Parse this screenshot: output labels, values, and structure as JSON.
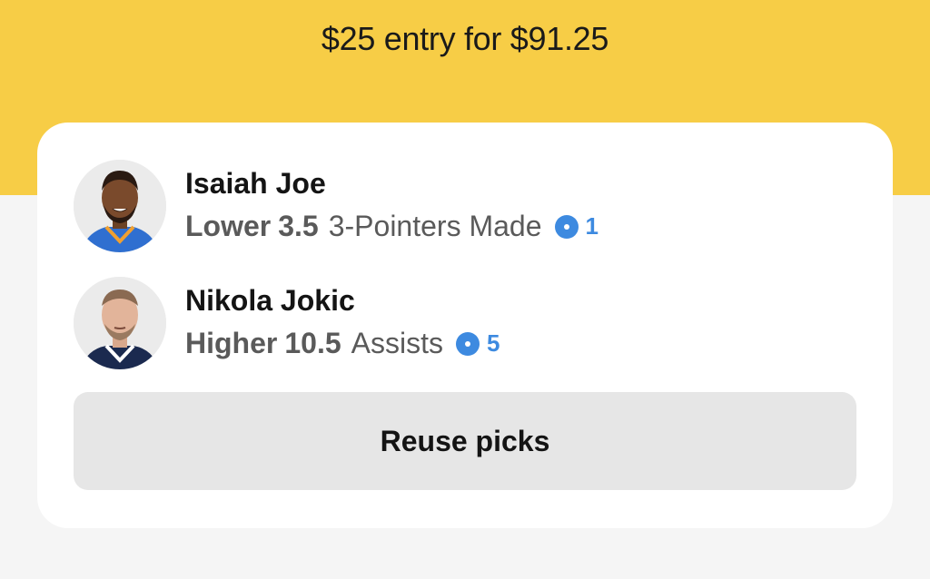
{
  "header": {
    "title": "$25 entry for $91.25",
    "background_color": "#f7cd46"
  },
  "picks": [
    {
      "player": "Isaiah Joe",
      "direction": "Lower",
      "line": "3.5",
      "stat": "3-Pointers Made",
      "badge_icon": "target-dot-icon",
      "badge_count": "1",
      "jersey_color": "#2f6fd0"
    },
    {
      "player": "Nikola Jokic",
      "direction": "Higher",
      "line": "10.5",
      "stat": "Assists",
      "badge_icon": "target-dot-icon",
      "badge_count": "5",
      "jersey_color": "#1b2a4f"
    }
  ],
  "actions": {
    "reuse_label": "Reuse picks"
  },
  "colors": {
    "accent_blue": "#3d8ae0",
    "button_bg": "#e6e6e6"
  }
}
